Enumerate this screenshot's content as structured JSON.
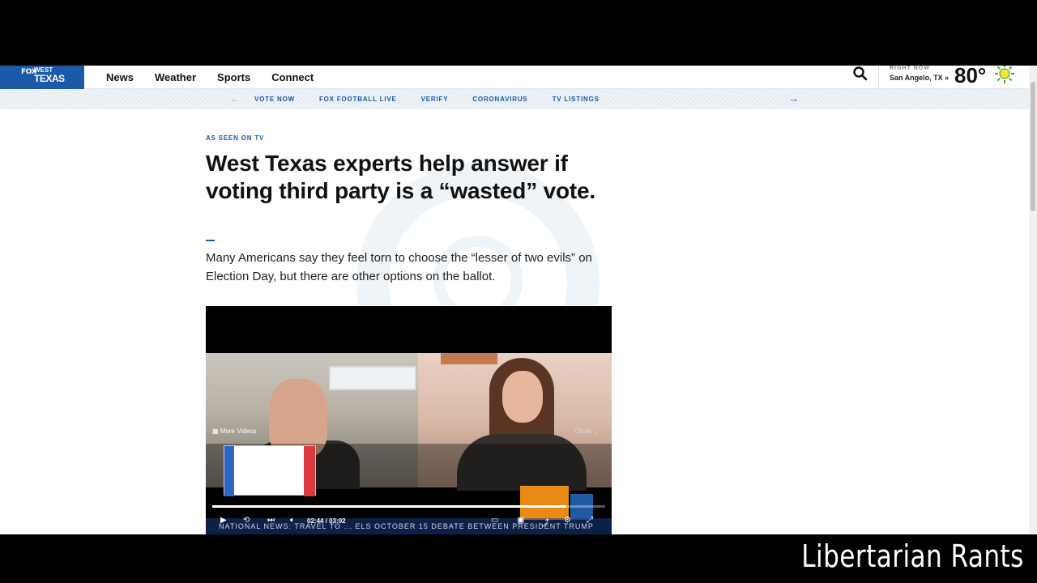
{
  "header": {
    "logo": {
      "brand": "FOX",
      "line1": "WEST",
      "line2": "TEXAS"
    },
    "nav": [
      "News",
      "Weather",
      "Sports",
      "Connect"
    ],
    "weather": {
      "label": "RIGHT NOW",
      "city": "San Angelo, TX »",
      "temp": "80°"
    }
  },
  "subnav": {
    "links": [
      "VOTE NOW",
      "FOX FOOTBALL LIVE",
      "VERIFY",
      "CORONAVIRUS",
      "TV LISTINGS"
    ],
    "prev_arrow": "←",
    "next_arrow": "→"
  },
  "article": {
    "kicker": "AS SEEN ON TV",
    "headline": "West Texas experts help answer if voting third party is a “wasted” vote.",
    "dek": "Many Americans say they feel torn to choose the “lesser of two evils” on Election Day, but there are other options on the ballot."
  },
  "video": {
    "more_videos": "More Videos",
    "close": "Close",
    "current_time": "02:44",
    "separator": "/",
    "duration": "03:02",
    "progress": 0.9,
    "ticker": "NATIONAL NEWS: TRAVEL TO ... ELS OCTOBER 15 DEBATE BETWEEN PRESIDENT TRUMP"
  },
  "overlay_brand": "Libertarian Rants",
  "colors": {
    "accent": "#1a5aa8",
    "background": "#ffffff",
    "letterbox": "#000000"
  }
}
